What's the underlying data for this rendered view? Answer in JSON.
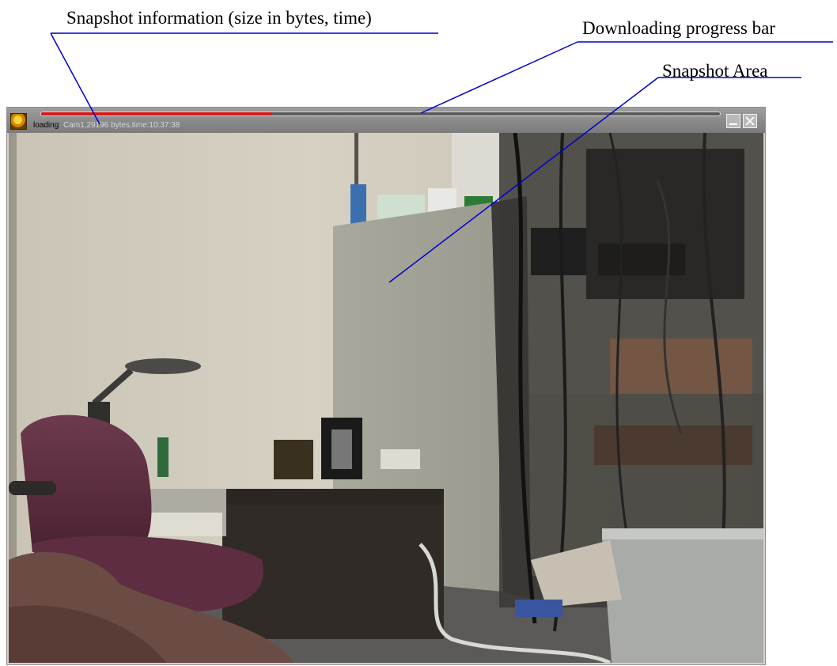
{
  "callouts": {
    "snapshot_info": "Snapshot information (size in bytes, time)",
    "progress_bar": "Downloading progress bar",
    "snapshot_area": "Snapshot Area"
  },
  "viewer": {
    "status_loading": "loading",
    "status_info": "Cam1,29196 bytes,time:10:37:38",
    "progress_fraction": 0.34,
    "icons": [
      "app-icon",
      "minimize-icon",
      "close-icon"
    ]
  },
  "colors": {
    "callout_line": "#0000cc",
    "progress_fill": "#d81818",
    "titlebar": "#8a8a8a"
  }
}
